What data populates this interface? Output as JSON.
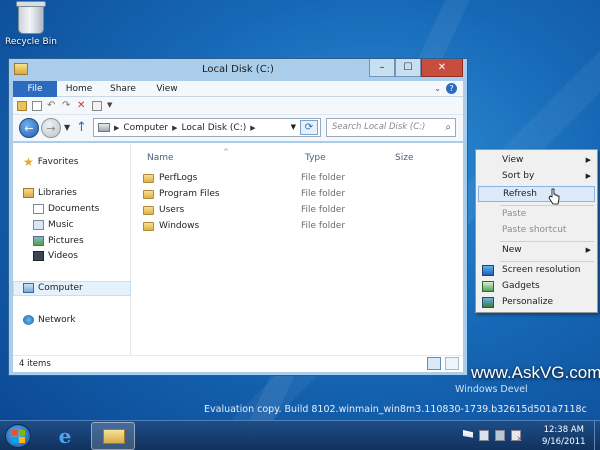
{
  "desktop": {
    "recycle_bin_label": "Recycle Bin"
  },
  "window": {
    "title": "Local Disk (C:)",
    "buttons": {
      "minimize": "–",
      "maximize": "☐",
      "close": "✕"
    },
    "ribbon_tabs": [
      {
        "label": "File",
        "active": true
      },
      {
        "label": "Home"
      },
      {
        "label": "Share"
      },
      {
        "label": "View"
      }
    ],
    "help_label": "?",
    "address": {
      "crumbs": [
        "Computer",
        "Local Disk (C:)"
      ],
      "search_placeholder": "Search Local Disk (C:)"
    },
    "navigation": {
      "favorites": "Favorites",
      "libraries": "Libraries",
      "library_items": [
        "Documents",
        "Music",
        "Pictures",
        "Videos"
      ],
      "computer": "Computer",
      "network": "Network",
      "selected": "Computer"
    },
    "columns": {
      "name": "Name",
      "type": "Type",
      "size": "Size"
    },
    "files": [
      {
        "name": "PerfLogs",
        "type": "File folder"
      },
      {
        "name": "Program Files",
        "type": "File folder"
      },
      {
        "name": "Users",
        "type": "File folder"
      },
      {
        "name": "Windows",
        "type": "File folder"
      }
    ],
    "status": {
      "item_count": "4 items"
    }
  },
  "context_menu": {
    "items": [
      {
        "label": "View",
        "submenu": true
      },
      {
        "label": "Sort by",
        "submenu": true
      },
      {
        "label": "Refresh",
        "hover": true
      },
      {
        "label": "Paste",
        "disabled": true
      },
      {
        "label": "Paste shortcut",
        "disabled": true
      },
      {
        "label": "New",
        "submenu": true
      },
      {
        "label": "Screen resolution",
        "icon": "screen-icon"
      },
      {
        "label": "Gadgets",
        "icon": "gadgets-icon"
      },
      {
        "label": "Personalize",
        "icon": "personalize-icon"
      }
    ]
  },
  "watermark": {
    "site": "www.AskVG.com",
    "edition": "Windows Devel",
    "build": "Evaluation copy. Build 8102.winmain_win8m3.110830-1739.b32615d501a7118c"
  },
  "taskbar": {
    "time": "12:38 AM",
    "date": "9/16/2011"
  },
  "colors": {
    "desktop": "#1668b6",
    "file_tab": "#2b6cc0",
    "close_button": "#c74d3e",
    "menu_hover": "#dbe9f8"
  }
}
